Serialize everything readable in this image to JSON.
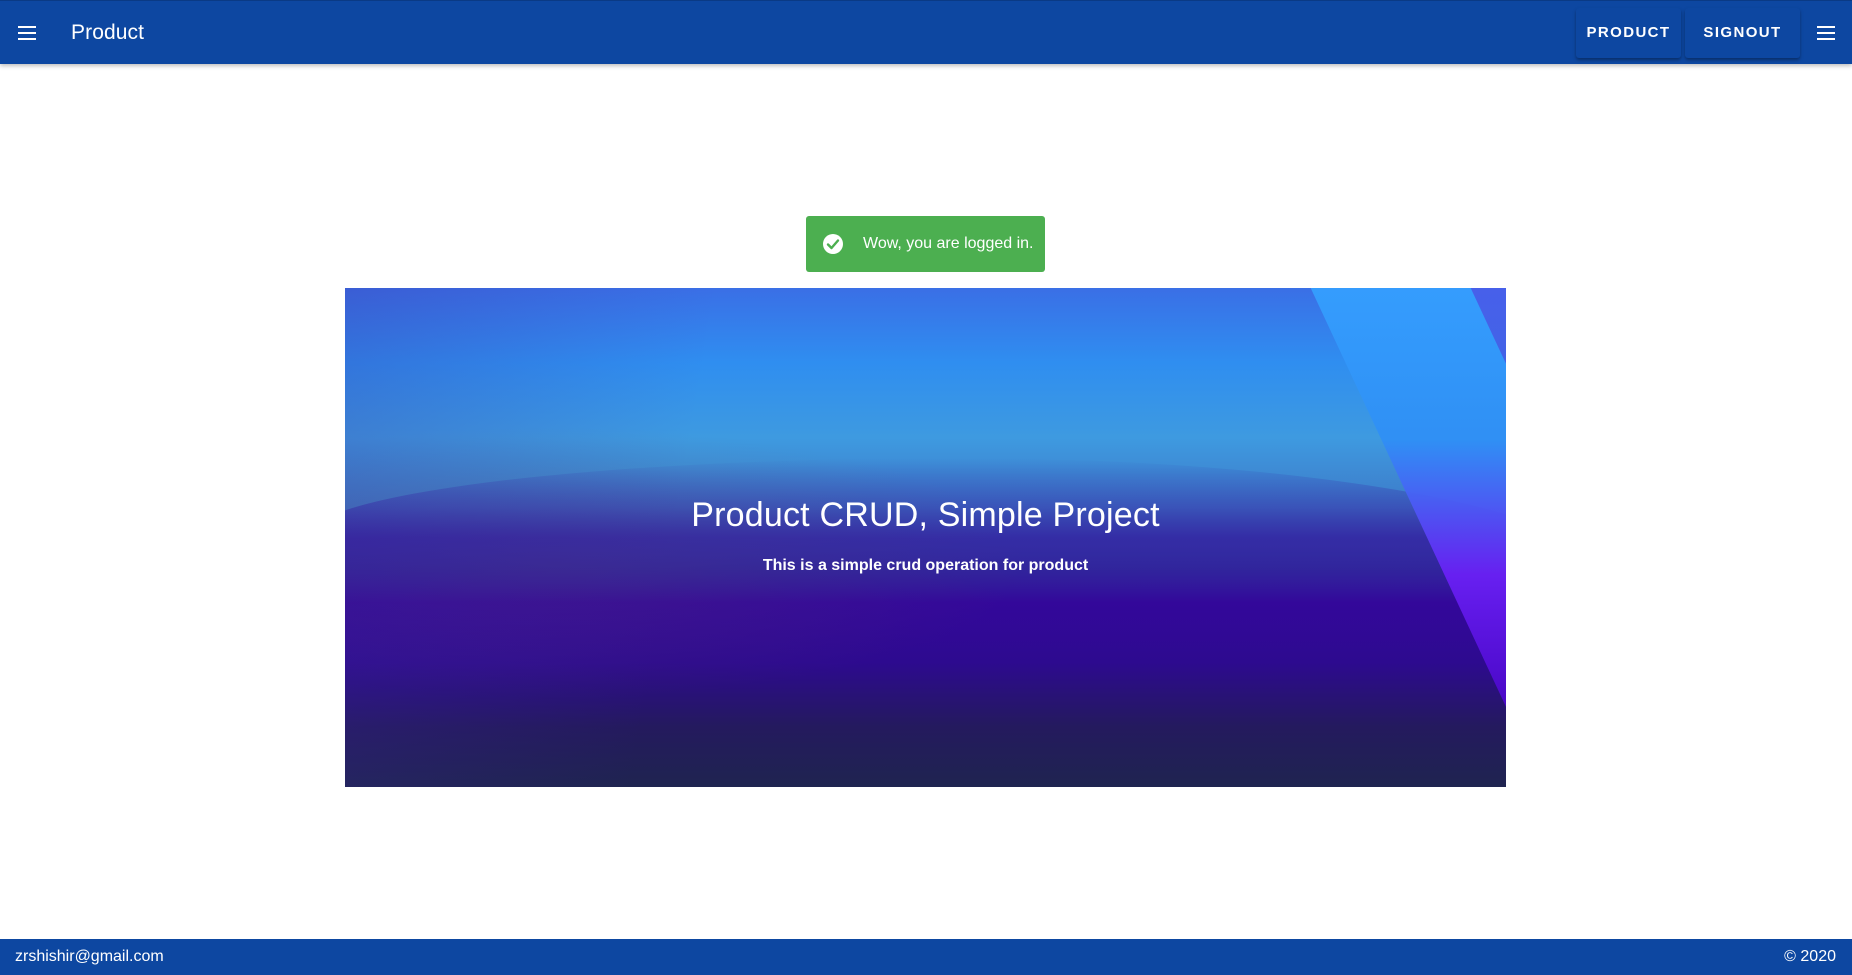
{
  "app_bar": {
    "title": "Product",
    "left_icon": "menu-icon",
    "right_icon": "menu-icon",
    "buttons": {
      "product": "PRODUCT",
      "signout": "SIGNOUT"
    },
    "color": "#0d47a1"
  },
  "alert": {
    "icon": "check-circle-icon",
    "message": "Wow, you are logged in.",
    "color": "#4caf50"
  },
  "hero": {
    "title": "Product CRUD, Simple Project",
    "subtitle": "This is a simple crud operation for product"
  },
  "footer": {
    "email": "zrshishir@gmail.com",
    "copyright": "© 2020"
  }
}
